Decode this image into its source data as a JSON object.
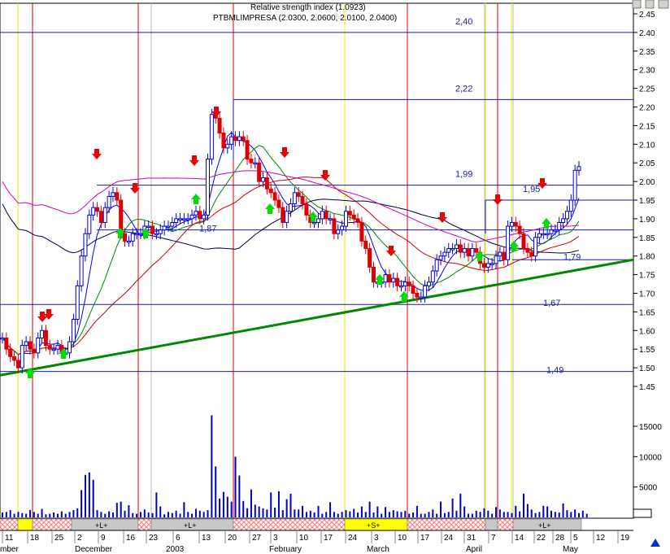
{
  "chart_data": {
    "type": "candlestick",
    "title": "PTBMLIMPRESA (2.0300, 2.0600, 2.0100, 2.0400)",
    "title_overlay": "Relative strength index (1.0923)",
    "ylim": [
      1.43,
      2.46
    ],
    "y_ticks": [
      "1.45",
      "1.50",
      "1.55",
      "1.60",
      "1.65",
      "1.70",
      "1.75",
      "1.80",
      "1.85",
      "1.90",
      "1.95",
      "2.00",
      "2.05",
      "2.10",
      "2.15",
      "2.20",
      "2.25",
      "2.30",
      "2.35",
      "2.40",
      "2.45"
    ],
    "volume_ticks": [
      "5000",
      "10000",
      "15000"
    ],
    "volume_ylim": [
      0,
      20000
    ],
    "x_day_labels": [
      "11",
      "18",
      "25",
      "2",
      "9",
      "16",
      "23",
      "6",
      "13",
      "20",
      "27",
      "3",
      "10",
      "17",
      "24",
      "3",
      "10",
      "17",
      "24",
      "31",
      "7",
      "14",
      "22",
      "28",
      "5",
      "12",
      "19"
    ],
    "x_month_labels": [
      "mber",
      "December",
      "2003",
      "February",
      "March",
      "April",
      "May"
    ],
    "horizontal_levels": [
      {
        "label": "2,40",
        "value": 2.4
      },
      {
        "label": "2,22",
        "value": 2.22
      },
      {
        "label": "1,99",
        "value": 1.99
      },
      {
        "label": "1,95",
        "value": 1.95
      },
      {
        "label": "1,87",
        "value": 1.87
      },
      {
        "label": "1,79",
        "value": 1.79
      },
      {
        "label": "1,67",
        "value": 1.67
      },
      {
        "label": "1,49",
        "value": 1.49
      }
    ],
    "trendline": {
      "from": {
        "x": "Nov 11",
        "y": 1.48
      },
      "to": {
        "x": "May 19",
        "y": 1.79
      }
    },
    "vertical_markers": {
      "red_dates": [
        "Nov 18",
        "Dec 23",
        "Jan 20",
        "Mar 13",
        "Apr 14"
      ],
      "yellow_dates": [
        "Nov 13",
        "Feb 24",
        "Apr 7"
      ]
    },
    "signal_band": {
      "labels": [
        "+L+",
        "+L+",
        "+S+",
        "+L+"
      ],
      "colors": {
        "L": "#c8c8c8",
        "S": "#ffff00",
        "hatch": "#ff9a9a"
      }
    },
    "series": [
      {
        "name": "close",
        "values": [
          1.58,
          1.55,
          1.53,
          1.52,
          1.5,
          1.56,
          1.57,
          1.55,
          1.54,
          1.58,
          1.6,
          1.56,
          1.55,
          1.55,
          1.56,
          1.54,
          1.54,
          1.57,
          1.63,
          1.72,
          1.8,
          1.86,
          1.91,
          1.93,
          1.92,
          1.89,
          1.93,
          1.96,
          1.97,
          1.95,
          1.86,
          1.84,
          1.84,
          1.86,
          1.86,
          1.86,
          1.88,
          1.88,
          1.86,
          1.86,
          1.87,
          1.88,
          1.88,
          1.89,
          1.9,
          1.9,
          1.9,
          1.9,
          1.91,
          1.92,
          1.9,
          1.91,
          2.06,
          2.18,
          2.17,
          2.13,
          2.09,
          2.1,
          2.12,
          2.11,
          2.12,
          2.11,
          2.06,
          2.05,
          2.05,
          2.0,
          2.01,
          1.98,
          1.97,
          1.95,
          1.93,
          1.89,
          1.92,
          1.94,
          1.97,
          1.96,
          1.94,
          1.91,
          1.89,
          1.89,
          1.9,
          1.92,
          1.9,
          1.9,
          1.86,
          1.87,
          1.88,
          1.92,
          1.91,
          1.9,
          1.89,
          1.84,
          1.82,
          1.77,
          1.73,
          1.73,
          1.73,
          1.75,
          1.73,
          1.74,
          1.72,
          1.72,
          1.73,
          1.72,
          1.7,
          1.69,
          1.69,
          1.72,
          1.73,
          1.76,
          1.79,
          1.8,
          1.81,
          1.82,
          1.82,
          1.83,
          1.81,
          1.82,
          1.8,
          1.82,
          1.81,
          1.78,
          1.77,
          1.78,
          1.78,
          1.8,
          1.81,
          1.79,
          1.88,
          1.89,
          1.88,
          1.86,
          1.82,
          1.81,
          1.8,
          1.85,
          1.86,
          1.86,
          1.86,
          1.87,
          1.87,
          1.89,
          1.9,
          1.92,
          1.95,
          2.03,
          2.04
        ]
      },
      {
        "name": "volume",
        "values": [
          800,
          900,
          1200,
          600,
          900,
          700,
          600,
          1200,
          900,
          600,
          1400,
          500,
          600,
          800,
          600,
          1000,
          600,
          900,
          1200,
          1500,
          4500,
          7000,
          7400,
          6200,
          1200,
          900,
          600,
          1000,
          800,
          2400,
          2600,
          1100,
          2000,
          700,
          600,
          900,
          1300,
          800,
          700,
          4100,
          1800,
          500,
          900,
          700,
          1100,
          600,
          2500,
          900,
          600,
          1400,
          1100,
          900,
          1200,
          16800,
          8400,
          3100,
          4200,
          3400,
          2600,
          10000,
          6900,
          2700,
          1500,
          4600,
          2100,
          1800,
          1500,
          1300,
          4100,
          1600,
          4300,
          1200,
          3000,
          3900,
          1300,
          1300,
          1900,
          900,
          1100,
          800,
          1900,
          600,
          900,
          2500,
          900,
          600,
          900,
          1200,
          1000,
          1400,
          800,
          1800,
          900,
          2600,
          800,
          1800,
          600,
          1700,
          900,
          1200,
          1000,
          900,
          1100,
          600,
          800,
          1900,
          600,
          600,
          900,
          1300,
          600,
          2600,
          700,
          900,
          3100,
          1100,
          3900,
          1800,
          600,
          600,
          1100,
          900,
          1500,
          1100,
          600,
          1700,
          1300,
          900,
          900,
          700,
          1900,
          1000,
          3900,
          2200,
          1300,
          700,
          900,
          1900,
          1800,
          1100,
          900,
          800,
          2300,
          1200,
          900,
          1300,
          700,
          1100,
          600
        ]
      }
    ]
  }
}
